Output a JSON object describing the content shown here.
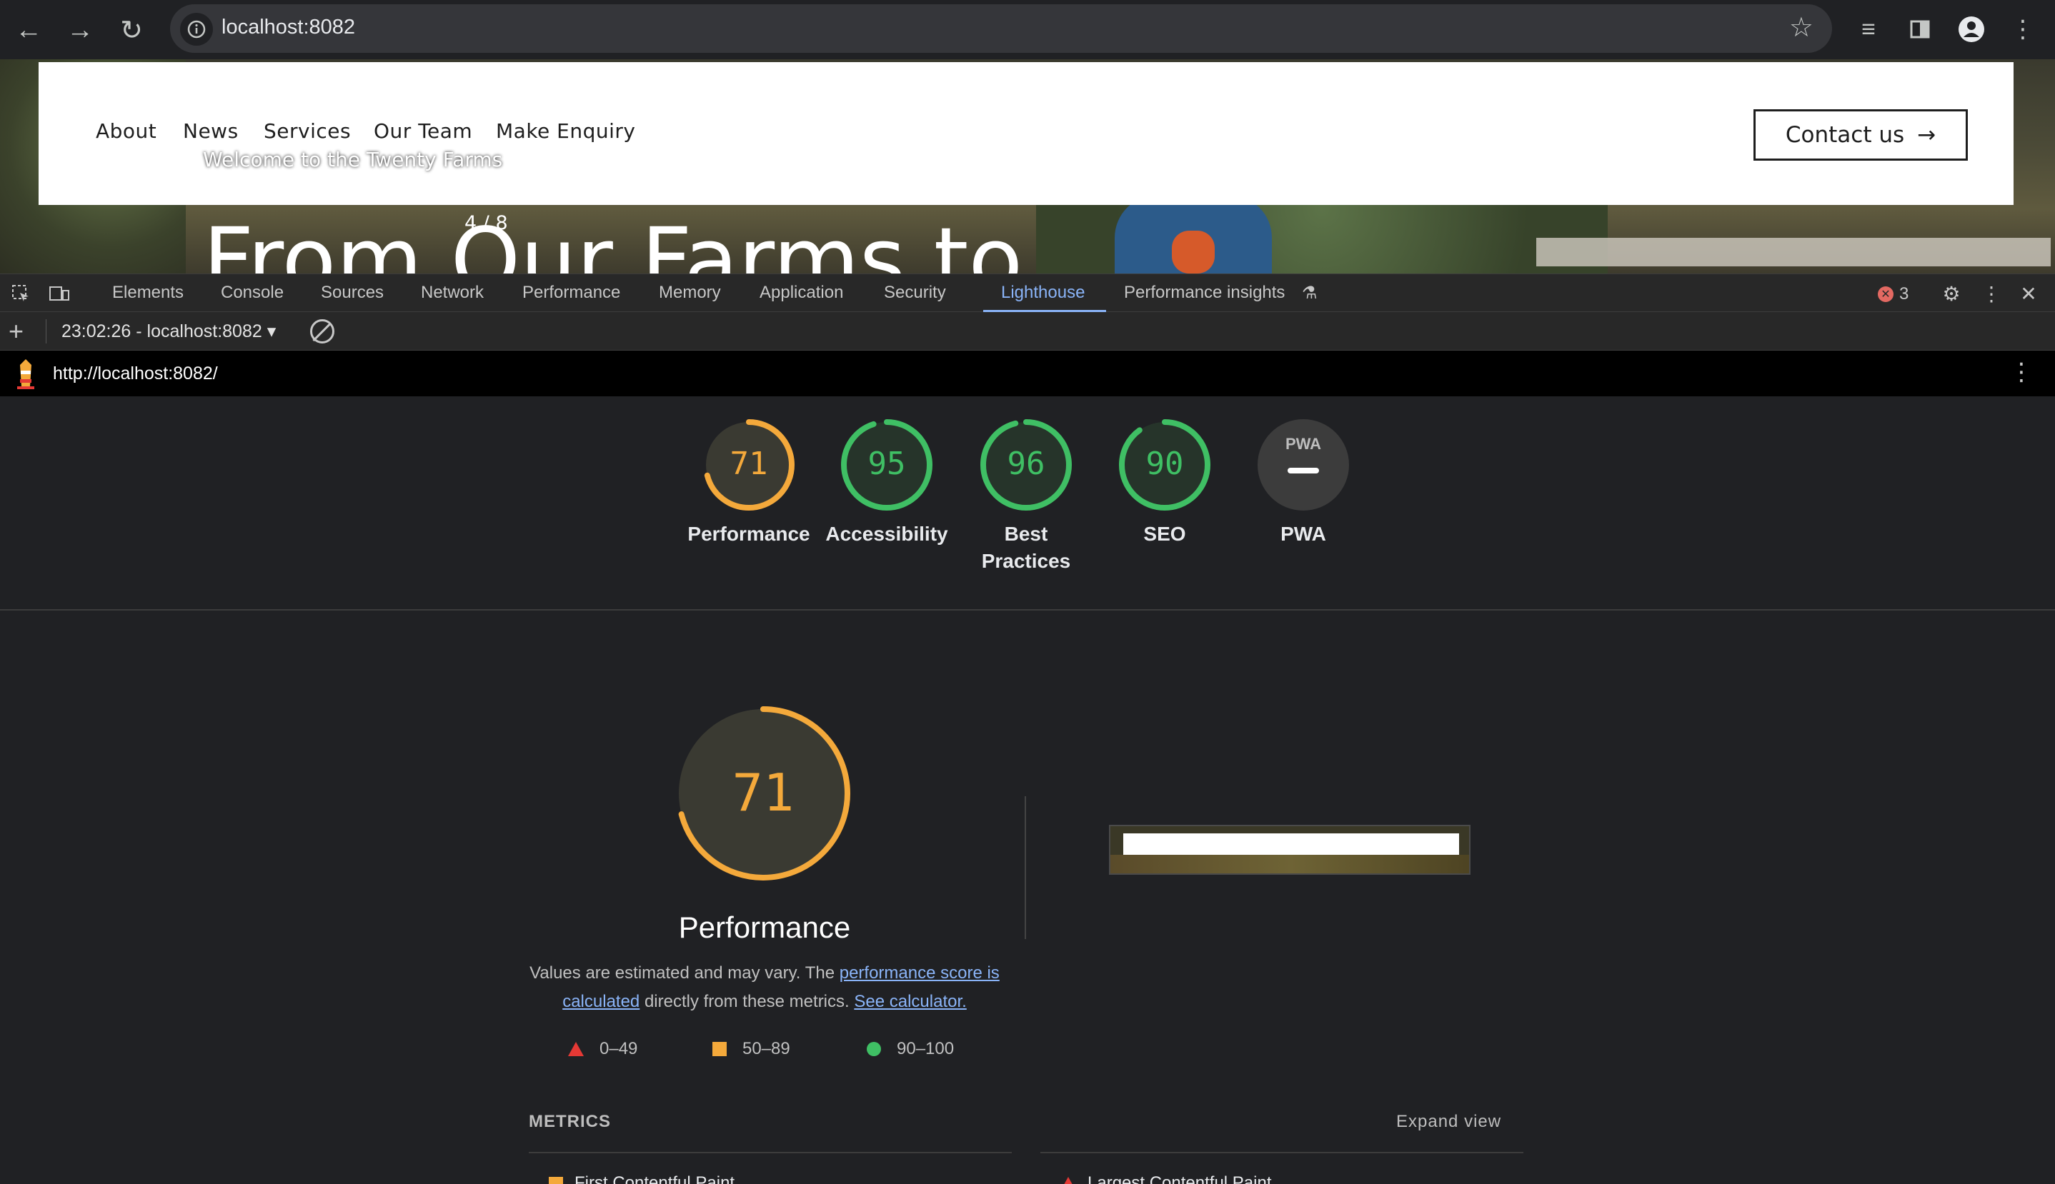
{
  "browser": {
    "url": "localhost:8082",
    "nav": {
      "back_icon": "arrow-left",
      "forward_icon": "arrow-right",
      "reload_icon": "reload"
    }
  },
  "site": {
    "nav_links": [
      "About",
      "News",
      "Services",
      "Our Team",
      "Make Enquiry"
    ],
    "contact_label": "Contact us",
    "welcome": "Welcome to the Twenty Farms",
    "counter": "4 / 8",
    "hero_title": "From Our Farms to"
  },
  "devtools": {
    "tabs": [
      "Elements",
      "Console",
      "Sources",
      "Network",
      "Performance",
      "Memory",
      "Application",
      "Security",
      "Lighthouse",
      "Performance insights"
    ],
    "active_tab": "Lighthouse",
    "error_count": "3",
    "report_selector": "23:02:26 - localhost:8082"
  },
  "lighthouse": {
    "url": "http://localhost:8082/",
    "categories": [
      {
        "name": "Performance",
        "score": "71",
        "color": "#f4a93b"
      },
      {
        "name": "Accessibility",
        "score": "95",
        "color": "#3fbf64"
      },
      {
        "name": "Best Practices",
        "score": "96",
        "color": "#3fbf64"
      },
      {
        "name": "SEO",
        "score": "90",
        "color": "#3fbf64"
      },
      {
        "name": "PWA",
        "score": "",
        "color": "#9aa0a6"
      }
    ],
    "pwa_badge": "PWA",
    "performance": {
      "score": "71",
      "title": "Performance",
      "desc_prefix": "Values are estimated and may vary. The ",
      "desc_link1": "performance score is calculated",
      "desc_middle": " directly from these metrics. ",
      "desc_link2": "See calculator."
    },
    "legend": [
      {
        "range": "0–49",
        "shape": "triangle",
        "color": "#e53935"
      },
      {
        "range": "50–89",
        "shape": "square",
        "color": "#f4a93b"
      },
      {
        "range": "90–100",
        "shape": "circle",
        "color": "#3fbf64"
      }
    ],
    "metrics_heading": "METRICS",
    "expand_label": "Expand view",
    "metric_peek": [
      "First Contentful Paint",
      "Largest Contentful Paint"
    ]
  }
}
